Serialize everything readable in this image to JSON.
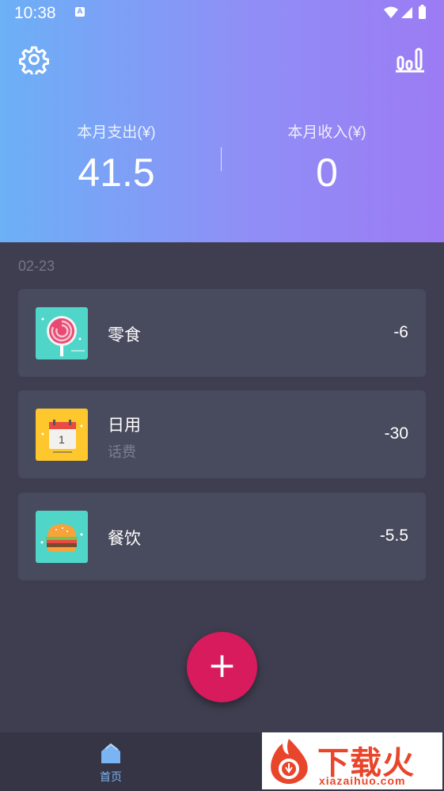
{
  "status_bar": {
    "time": "10:38",
    "notification_badge": "A"
  },
  "header": {
    "settings_icon": "gear-icon",
    "stats_icon": "bar-chart-icon",
    "expense_label": "本月支出(¥)",
    "expense_value": "41.5",
    "income_label": "本月收入(¥)",
    "income_value": "0"
  },
  "records": {
    "date": "02-23",
    "items": [
      {
        "icon": "lollipop-icon",
        "title": "零食",
        "note": "",
        "amount": "-6"
      },
      {
        "icon": "calendar-icon",
        "title": "日用",
        "note": "话费",
        "amount": "-30"
      },
      {
        "icon": "burger-icon",
        "title": "餐饮",
        "note": "",
        "amount": "-5.5"
      }
    ]
  },
  "fab": {
    "label": "+"
  },
  "bottom_nav": {
    "home_label": "首页"
  },
  "watermark": {
    "text": "下载火",
    "sub": "xiazaihuo.com"
  },
  "colors": {
    "header_gradient_start": "#6cb0f6",
    "header_gradient_end": "#9c7bf4",
    "background": "#3e3e50",
    "card": "#484a5d",
    "fab": "#d81b5c",
    "nav_active": "#7ab4f2"
  }
}
